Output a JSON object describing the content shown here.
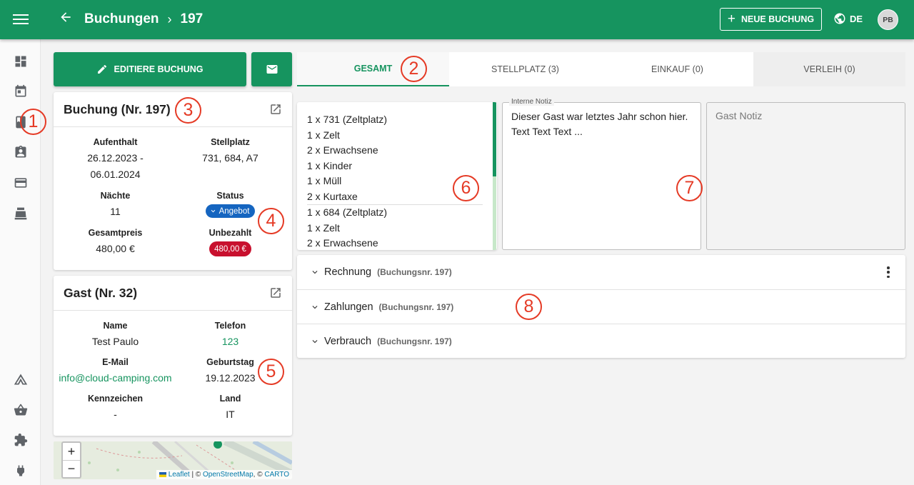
{
  "header": {
    "breadcrumb_root": "Buchungen",
    "breadcrumb_sep": "›",
    "breadcrumb_current": "197",
    "new_booking_label": "NEUE BUCHUNG",
    "language": "DE",
    "avatar_initials": "PB"
  },
  "colors": {
    "primary": "#16945f",
    "annotation": "#e53a25",
    "badge_offer": "#1565c0",
    "badge_unpaid": "#c8102e"
  },
  "sidebar": {
    "items": [
      {
        "icon": "dashboard-icon"
      },
      {
        "icon": "calendar-icon"
      },
      {
        "icon": "bookings-icon"
      },
      {
        "icon": "guest-contact-icon"
      },
      {
        "icon": "credit-card-icon"
      },
      {
        "icon": "cash-register-icon"
      },
      {
        "icon": "tent-icon"
      },
      {
        "icon": "shopping-basket-icon"
      },
      {
        "icon": "extension-icon"
      },
      {
        "icon": "power-plug-icon"
      }
    ]
  },
  "annotations": [
    "1",
    "2",
    "3",
    "4",
    "5",
    "6",
    "7",
    "8"
  ],
  "actions": {
    "edit_label": "EDITIERE BUCHUNG"
  },
  "booking": {
    "title": "Buchung (Nr. 197)",
    "stay_label": "Aufenthalt",
    "stay_value": "26.12.2023 - 06.01.2024",
    "pitch_label": "Stellplatz",
    "pitch_value": "731, 684, A7",
    "nights_label": "Nächte",
    "nights_value": "11",
    "status_label": "Status",
    "status_value": "Angebot",
    "total_label": "Gesamtpreis",
    "total_value": "480,00 €",
    "unpaid_label": "Unbezahlt",
    "unpaid_value": "480,00 €"
  },
  "guest": {
    "title": "Gast (Nr. 32)",
    "name_label": "Name",
    "name_value": "Test Paulo",
    "phone_label": "Telefon",
    "phone_value": "123",
    "email_label": "E-Mail",
    "email_value": "info@cloud-camping.com",
    "birthday_label": "Geburtstag",
    "birthday_value": "19.12.2023",
    "plate_label": "Kennzeichen",
    "plate_value": "-",
    "country_label": "Land",
    "country_value": "IT"
  },
  "map": {
    "zoom_in": "+",
    "zoom_out": "−",
    "attrib_leaflet": "Leaflet",
    "attrib_sep1": "| ©",
    "attrib_osm": "OpenStreetMap",
    "attrib_sep2": ", ©",
    "attrib_carto": "CARTO"
  },
  "tabs": [
    {
      "label": "GESAMT"
    },
    {
      "label": "STELLPLATZ (3)"
    },
    {
      "label": "EINKAUF (0)"
    },
    {
      "label": "VERLEIH (0)"
    }
  ],
  "positions": {
    "group1": [
      "1 x 731 (Zeltplatz)",
      "1 x Zelt",
      "2 x Erwachsene",
      "1 x Kinder",
      "1 x Müll",
      "2 x Kurtaxe"
    ],
    "group2": [
      "1 x 684 (Zeltplatz)",
      "1 x Zelt",
      "2 x Erwachsene"
    ]
  },
  "notes": {
    "internal_label": "Interne Notiz",
    "internal_text": "Dieser Gast war letztes Jahr schon hier. Text Text Text ...",
    "guest_placeholder": "Gast Notiz"
  },
  "accordion": [
    {
      "title": "Rechnung",
      "subtitle": "(Buchungsnr. 197)"
    },
    {
      "title": "Zahlungen",
      "subtitle": "(Buchungsnr. 197)"
    },
    {
      "title": "Verbrauch",
      "subtitle": "(Buchungsnr. 197)"
    }
  ]
}
